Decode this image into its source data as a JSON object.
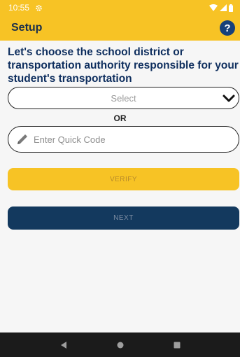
{
  "status_bar": {
    "time": "10:55",
    "settings_icon": "gear-icon",
    "wifi_icon": "wifi-icon",
    "signal_icon": "signal-icon",
    "battery_icon": "battery-icon"
  },
  "app_bar": {
    "title": "Setup",
    "help_label": "?"
  },
  "main": {
    "heading": "Let's choose the school district or transportation authority responsible for your student's transportation",
    "select": {
      "value": "Select"
    },
    "or_label": "OR",
    "quick_code": {
      "placeholder": "Enter Quick Code",
      "value": ""
    },
    "verify_label": "VERIFY",
    "next_label": "NEXT"
  },
  "nav_bar": {
    "back_icon": "back-icon",
    "home_icon": "home-icon",
    "recents_icon": "recents-icon"
  },
  "colors": {
    "accent": "#f7c325",
    "primary": "#13395e",
    "heading": "#0e2e5e"
  }
}
